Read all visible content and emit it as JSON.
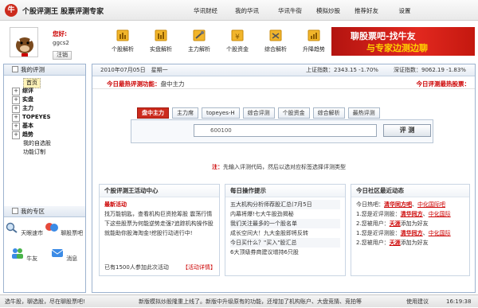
{
  "app": {
    "title": "个股评测王 股票评测专家",
    "logo_text": "牛"
  },
  "topnav": [
    "华讯财经",
    "我的华讯",
    "华讯牛街",
    "模拟炒股",
    "推荐好友",
    "设置"
  ],
  "user": {
    "label": "您好:",
    "name": "ggcs2",
    "logout": "注销"
  },
  "toolbar": [
    "个股解析",
    "实盘解析",
    "主力解析",
    "个股资金",
    "综合解析",
    "升降趋势"
  ],
  "banner": {
    "line1": "聊股票吧-找牛友",
    "line2": "与专家边测边聊"
  },
  "sidebar": {
    "header": "我的评测",
    "items": [
      {
        "label": "首页",
        "type": "home"
      },
      {
        "label": "综评",
        "type": "plus"
      },
      {
        "label": "实盘",
        "type": "plus"
      },
      {
        "label": "主力",
        "type": "plus"
      },
      {
        "label": "TOPEYES",
        "type": "plus"
      },
      {
        "label": "基本",
        "type": "plus"
      },
      {
        "label": "趋势",
        "type": "plus"
      },
      {
        "label": "我的自选股",
        "type": "indent"
      },
      {
        "label": "功能订制",
        "type": "indent"
      }
    ],
    "zone_header": "我的专区",
    "zone": [
      "天眼速市",
      "聊股票吧",
      "牛友",
      "消息"
    ]
  },
  "datebar": {
    "date": "2010年07月05日　星期一",
    "sh": "上证指数：2343.15 -1.70%",
    "sz": "深证指数：9062.19 -1.83%"
  },
  "hot": {
    "label": "今日最热评测功能：",
    "value": "盘中主力",
    "right": "今日评测最热股票："
  },
  "tabs": [
    "盘中主力",
    "主力席",
    "topeyes-H",
    "综合评测",
    "个股资金",
    "综合解析",
    "最热评测"
  ],
  "search": {
    "value": "600100",
    "button": "评 测"
  },
  "hint": {
    "prefix": "注：",
    "text": "先输入评测代码，然后以选对应标签选择评测类型"
  },
  "activity": {
    "title": "个股评测王活动中心",
    "newest": "最新活动",
    "text": "找万能钥匙，查看机构巨资抢筹股 震荡行情下这些股票为何能逆势走强?追踪机构操作股就能助你股海淘金!挖股行动进行中!",
    "participants": "已有1500人参加此次活动",
    "detail": "【活动详情】"
  },
  "daily": {
    "title": "每日操作提示",
    "items": [
      "五大机构分析师荐股汇总(7月5日",
      "内幕将爆!七大牛股劲揭秘",
      "我们关注最多的一个股名单",
      "成长空间大！九大金股即将反转",
      "今日买什么？\"买入\"股汇总",
      "6大顶级券商建议增持6只股"
    ]
  },
  "community": {
    "title": "今日社区最近动态",
    "items": [
      {
        "pre": "今日热吧：",
        "u": "清华同方吧",
        "mid": "、",
        "t": "中化国际吧"
      },
      {
        "pre": "1.您是近评测股：",
        "u": "清华同方",
        "mid": "、",
        "t": "中化国际"
      },
      {
        "pre": "2.您被用户：",
        "u": "天涯",
        "mid": "",
        "t": "添加为好友"
      },
      {
        "pre": "1.您是近评测股：",
        "u": "清华同方",
        "mid": "、",
        "t": "中化国际"
      },
      {
        "pre": "2.您被用户：",
        "u": "天涯",
        "mid": "",
        "t": "添加为好友"
      }
    ]
  },
  "status": {
    "left": "选牛股，聊选股，尽在聊股票吧!",
    "ticker": "新版模拟炒股隆重上线了。新版中升级原有的功能，还增加了机构账户、大盘竞猜、竞拍等",
    "help": "使用建议",
    "time": "16:19:38"
  }
}
